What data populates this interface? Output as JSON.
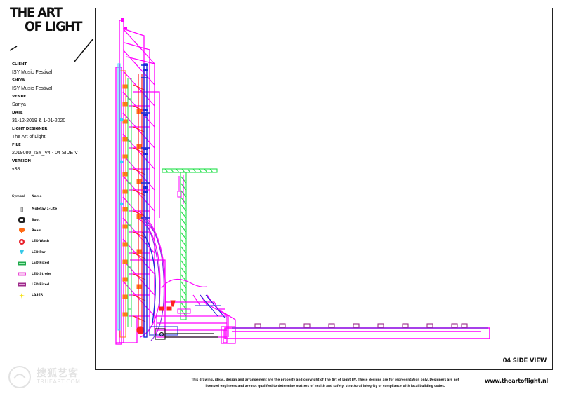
{
  "logo": {
    "line1": "THE ART",
    "line2": "OF LIGHT"
  },
  "meta": [
    {
      "label": "CLIENT",
      "value": "ISY Music Festival"
    },
    {
      "label": "SHOW",
      "value": "ISY Music Festival"
    },
    {
      "label": "VENUE",
      "value": "Sanya"
    },
    {
      "label": "DATE",
      "value": "31-12-2019 & 1-01-2020"
    },
    {
      "label": "LIGHT DESIGNER",
      "value": "The Art of Light"
    },
    {
      "label": "FILE",
      "value": "2019080_ISY_V4 - 04 SIDE V"
    },
    {
      "label": "VERSION",
      "value": "v38"
    }
  ],
  "legend": {
    "symbol_header": "Symbol",
    "name_header": "Name",
    "items": [
      {
        "name": "Molefay 1-Lite",
        "icon": "molefay-icon",
        "color": "#888888"
      },
      {
        "name": "Spot",
        "icon": "spot-icon",
        "color": "#222222"
      },
      {
        "name": "Beam",
        "icon": "beam-icon",
        "color": "#ff6a13"
      },
      {
        "name": "LED Wash",
        "icon": "led-wash-icon",
        "color": "#e8202a"
      },
      {
        "name": "LED Par",
        "icon": "led-par-icon",
        "color": "#35c8e8"
      },
      {
        "name": "LED Fixed",
        "icon": "led-fixed-green-icon",
        "color": "#1fa84a"
      },
      {
        "name": "LED Strobe",
        "icon": "led-strobe-icon",
        "color": "#e94ad6"
      },
      {
        "name": "LED Fixed",
        "icon": "led-fixed-purple-icon",
        "color": "#9c2a8a"
      },
      {
        "name": "LASER",
        "icon": "laser-icon",
        "color": "#f5e21a"
      }
    ]
  },
  "view_title": "04 SIDE VIEW",
  "footer": {
    "note_line1": "This drawing, ideas, design and arrangement are the property and copyright of The Art of Light BV. These designs are for representation only. Designers are not",
    "note_line2": "licensed engineers and are not qualified to determine matters of health and safety, structural integrity or compliance with local building codes.",
    "url": "www.theartoflight.nl"
  },
  "watermark": {
    "cn": "搜狐艺客",
    "en": "TRUEART.COM"
  },
  "colors": {
    "magenta": "#ff00ff",
    "red": "#ff2020",
    "orange": "#ff7a1a",
    "green": "#22e04a",
    "cyan": "#33d6ff",
    "blue": "#1a2bd8",
    "purple": "#8a2be2",
    "dark": "#1a1a1a"
  }
}
